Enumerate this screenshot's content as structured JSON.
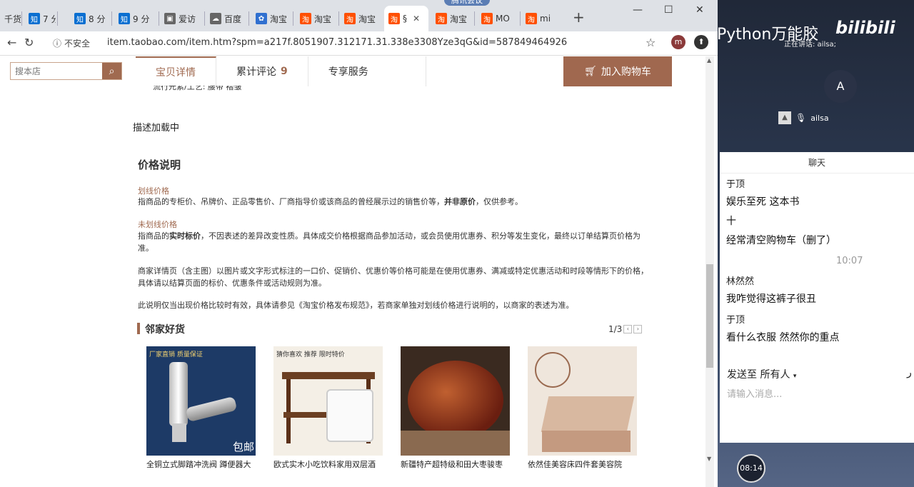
{
  "browser": {
    "tabs": [
      {
        "label": "千货",
        "icon": "taobao-icon"
      },
      {
        "label": "7 分",
        "icon": "zhihu-icon"
      },
      {
        "label": "8 分",
        "icon": "zhihu-icon"
      },
      {
        "label": "9 分",
        "icon": "zhihu-icon"
      },
      {
        "label": "爱访",
        "icon": "page-icon"
      },
      {
        "label": "百度",
        "icon": "cloud-icon"
      },
      {
        "label": "淘宝",
        "icon": "baidu-icon"
      },
      {
        "label": "淘宝",
        "icon": "zhihu-icon"
      },
      {
        "label": "淘宝",
        "icon": "zhihu-icon"
      },
      {
        "label": "§",
        "icon": "zhihu-icon"
      },
      {
        "label": "淘宝",
        "icon": "zhihu-icon"
      },
      {
        "label": "MO",
        "icon": "zhihu-icon"
      },
      {
        "label": "mi",
        "icon": "zhihu-icon"
      }
    ],
    "meeting_label": "腾讯会议",
    "security_label": "不安全",
    "url": "item.taobao.com/item.htm?spm=a217f.8051907.312171.31.338e3308Yze3qG&id=587849464926",
    "profile_initial": "m"
  },
  "shop": {
    "search_placeholder": "搜本店",
    "tabs": [
      {
        "label": "宝贝详情",
        "count": ""
      },
      {
        "label": "累计评论",
        "count": "9"
      },
      {
        "label": "专享服务",
        "count": ""
      }
    ],
    "cart_label": "加入购物车",
    "cutoff_text": "流行元素/工艺: 腰带 褶皱",
    "loading_text": "描述加载中",
    "price_title": "价格说明",
    "sections": [
      {
        "heading": "划线价格",
        "text_pre": "指商品的专柜价、吊牌价、正品零售价、厂商指导价或该商品的曾经展示过的销售价等，",
        "text_bold": "并非原价",
        "text_post": "，仅供参考。"
      },
      {
        "heading": "未划线价格",
        "text_pre": "指商品的",
        "text_bold": "实时标价",
        "text_post": "，不因表述的差异改变性质。具体成交价格根据商品参加活动，或会员使用优惠券、积分等发生变化，最终以订单结算页价格为准。"
      }
    ],
    "para3": "商家详情页（含主图）以图片或文字形式标注的一口价、促销价、优惠价等价格可能是在使用优惠券、满减或特定优惠活动和时段等情形下的价格，具体请以结算页面的标价、优惠条件或活动规则为准。",
    "para4": "此说明仅当出现价格比较时有效，具体请参见《淘宝价格发布规范》，若商家单独对划线价格进行说明的，以商家的表述为准。",
    "neighbor_title": "邻家好货",
    "pager": "1/3",
    "products": [
      {
        "name": "全铜立式脚踏冲洗阀 蹲便器大",
        "badge": "厂家直销 质量保证",
        "tag": "包邮"
      },
      {
        "name": "欧式实木小吃饮料家用双层酒",
        "badge": "猜你喜欢 推荐 限时特价",
        "tag": ""
      },
      {
        "name": "新疆特产超特级和田大枣骏枣",
        "badge": "",
        "tag": ""
      },
      {
        "name": "依然佳美容床四件套美容院",
        "badge": "",
        "tag": ""
      }
    ]
  },
  "side": {
    "title": "Python万能胶",
    "logo": "bilibili",
    "speaking": "正在讲话: ailsa;",
    "avatar_initial": "A",
    "participant": "ailsa",
    "chat_header": "聊天",
    "messages": [
      {
        "type": "name",
        "text": "于顶"
      },
      {
        "type": "msg",
        "text": "娱乐至死 这本书"
      },
      {
        "type": "msg",
        "text": "十"
      },
      {
        "type": "msg",
        "text": "经常清空购物车（删了）"
      },
      {
        "type": "time",
        "text": "10:07"
      },
      {
        "type": "name",
        "text": "林然然"
      },
      {
        "type": "msg",
        "text": "我咋觉得这裤子很丑"
      },
      {
        "type": "name",
        "text": "于顶"
      },
      {
        "type": "msg",
        "text": "看什么衣服  然然你的重点"
      }
    ],
    "send_to": "发送至 所有人",
    "send_extra": "ر",
    "input_placeholder": "请输入消息...",
    "timer": "08:14"
  }
}
